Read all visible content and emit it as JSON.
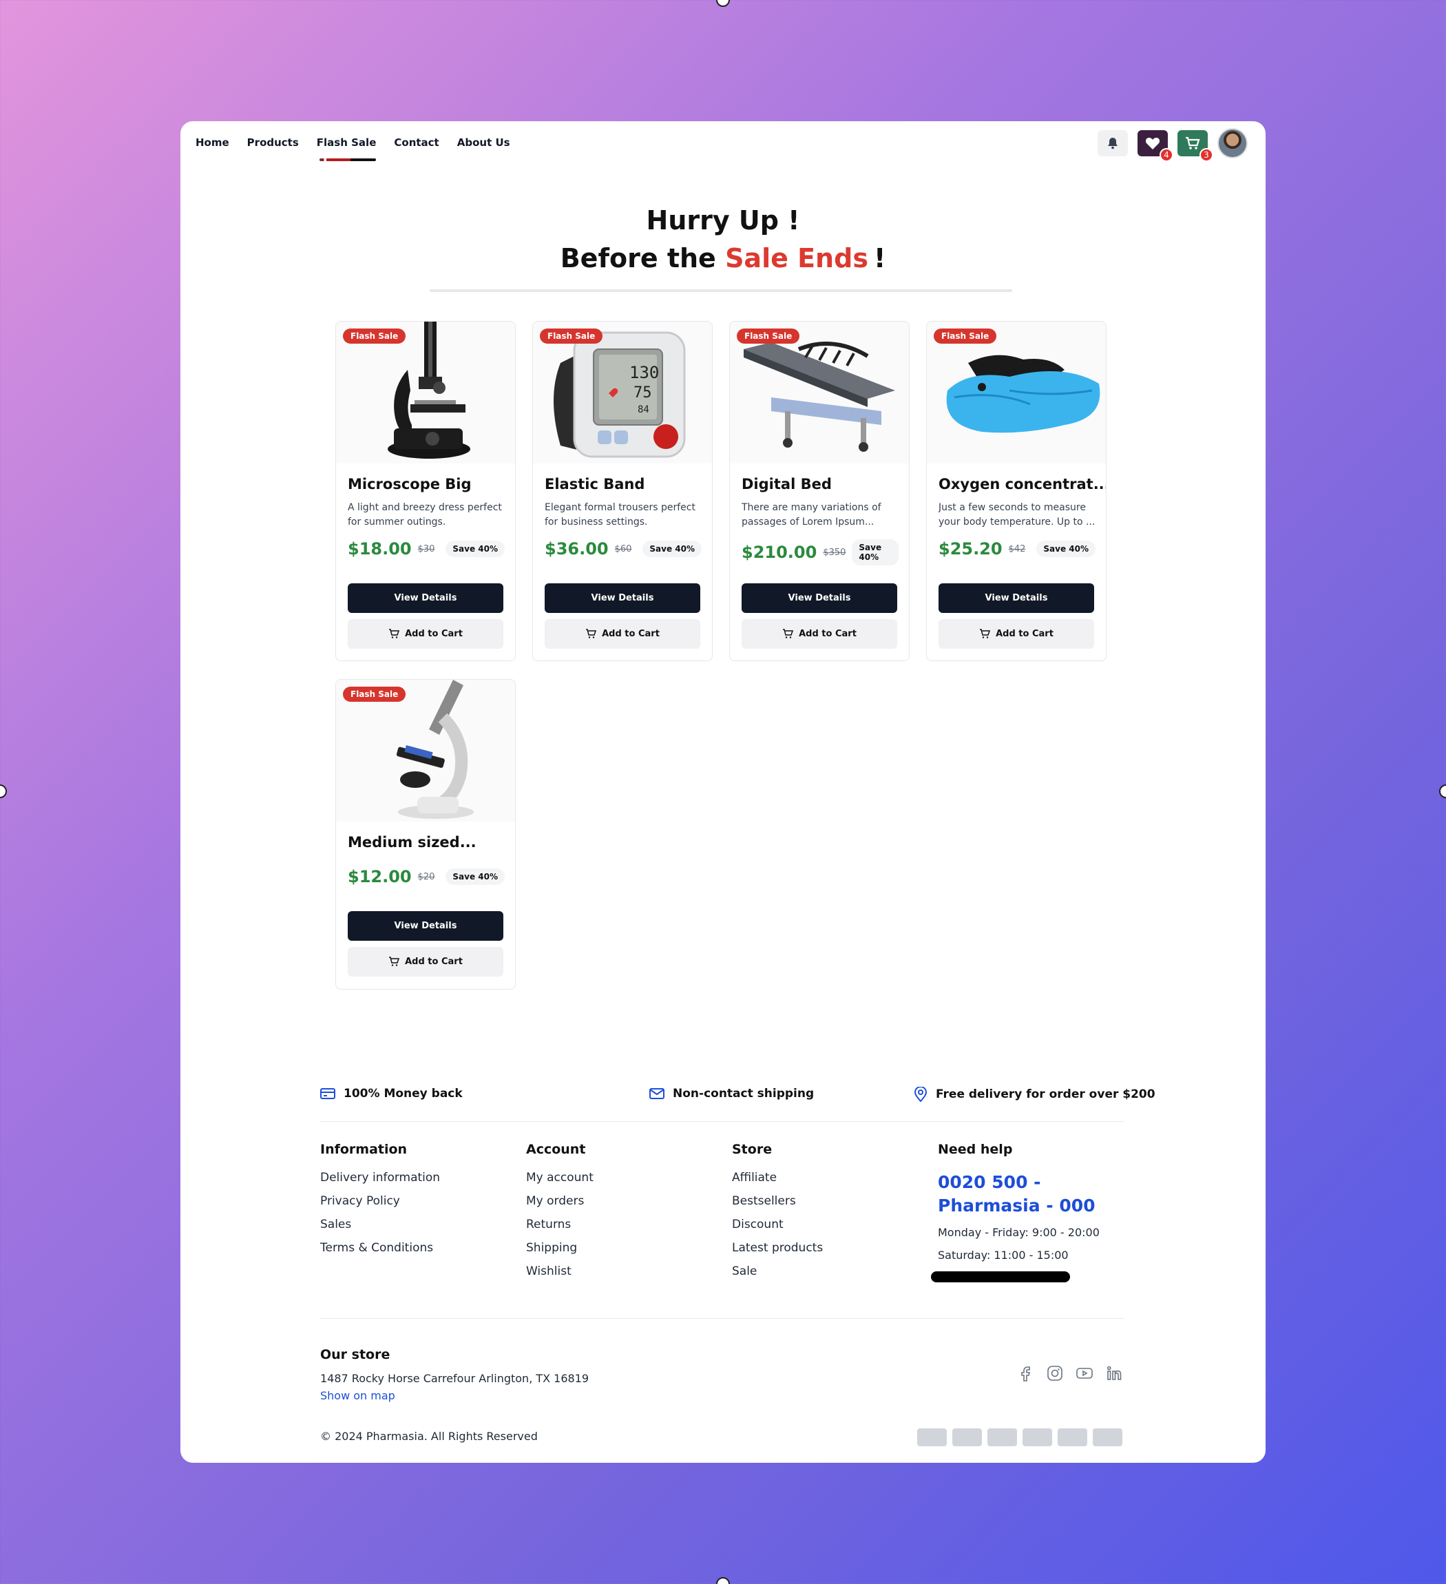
{
  "nav": {
    "items": [
      {
        "label": "Home",
        "active": false
      },
      {
        "label": "Products",
        "active": false
      },
      {
        "label": "Flash Sale",
        "active": true
      },
      {
        "label": "Contact",
        "active": false
      },
      {
        "label": "About Us",
        "active": false
      }
    ],
    "icons": {
      "bell": "bell-icon",
      "wishlist": "heart-icon",
      "cart": "cart-icon",
      "wishlist_count": "4",
      "cart_count": "3"
    }
  },
  "hero": {
    "line1": "Hurry Up !",
    "line2_prefix": "Before the",
    "line2_accent": "Sale Ends",
    "line2_suffix": "!",
    "accent_color": "#dc3a2f"
  },
  "products": [
    {
      "tag": "Flash Sale",
      "title": "Microscope Big",
      "description": "A light and breezy dress perfect for summer outings.",
      "price": "$18.00",
      "old_price": "$30",
      "save": "Save 40%",
      "view_label": "View Details",
      "cart_label": "Add to Cart"
    },
    {
      "tag": "Flash Sale",
      "title": "Elastic Band",
      "description": "Elegant formal trousers perfect for business settings.",
      "price": "$36.00",
      "old_price": "$60",
      "save": "Save 40%",
      "view_label": "View Details",
      "cart_label": "Add to Cart"
    },
    {
      "tag": "Flash Sale",
      "title": "Digital Bed",
      "description": "There are many variations of passages of Lorem Ipsum...",
      "price": "$210.00",
      "old_price": "$350",
      "save": "Save 40%",
      "view_label": "View Details",
      "cart_label": "Add to Cart"
    },
    {
      "tag": "Flash Sale",
      "title": "Oxygen concentrat...",
      "description": "Just a few seconds to measure your body temperature. Up to ...",
      "price": "$25.20",
      "old_price": "$42",
      "save": "Save 40%",
      "view_label": "View Details",
      "cart_label": "Add to Cart"
    },
    {
      "tag": "Flash Sale",
      "title": "Medium sized...",
      "description": "",
      "price": "$12.00",
      "old_price": "$20",
      "save": "Save 40%",
      "view_label": "View Details",
      "cart_label": "Add to Cart"
    }
  ],
  "features": [
    {
      "icon": "credit-card-icon",
      "label": "100% Money back"
    },
    {
      "icon": "mail-icon",
      "label": "Non-contact shipping"
    },
    {
      "icon": "map-pin-icon",
      "label": "Free delivery for order over $200"
    }
  ],
  "footer": {
    "information": {
      "title": "Information",
      "links": [
        "Delivery information",
        "Privacy Policy",
        "Sales",
        "Terms & Conditions"
      ]
    },
    "account": {
      "title": "Account",
      "links": [
        "My account",
        "My orders",
        "Returns",
        "Shipping",
        "Wishlist"
      ]
    },
    "store": {
      "title": "Store",
      "links": [
        "Affiliate",
        "Bestsellers",
        "Discount",
        "Latest products",
        "Sale"
      ]
    },
    "help": {
      "title": "Need help",
      "phone": "0020 500 - Pharmasia - 000",
      "hours_weekday": "Monday - Friday: 9:00 - 20:00",
      "hours_saturday": "Saturday: 11:00 - 15:00"
    },
    "our_store": {
      "title": "Our store",
      "address": "1487 Rocky Horse Carrefour Arlington, TX 16819",
      "map_link": "Show on map"
    },
    "copyright": "© 2024 Pharmasia. All Rights Reserved",
    "social_icons": [
      "facebook-icon",
      "instagram-icon",
      "youtube-icon",
      "linkedin-icon"
    ]
  }
}
